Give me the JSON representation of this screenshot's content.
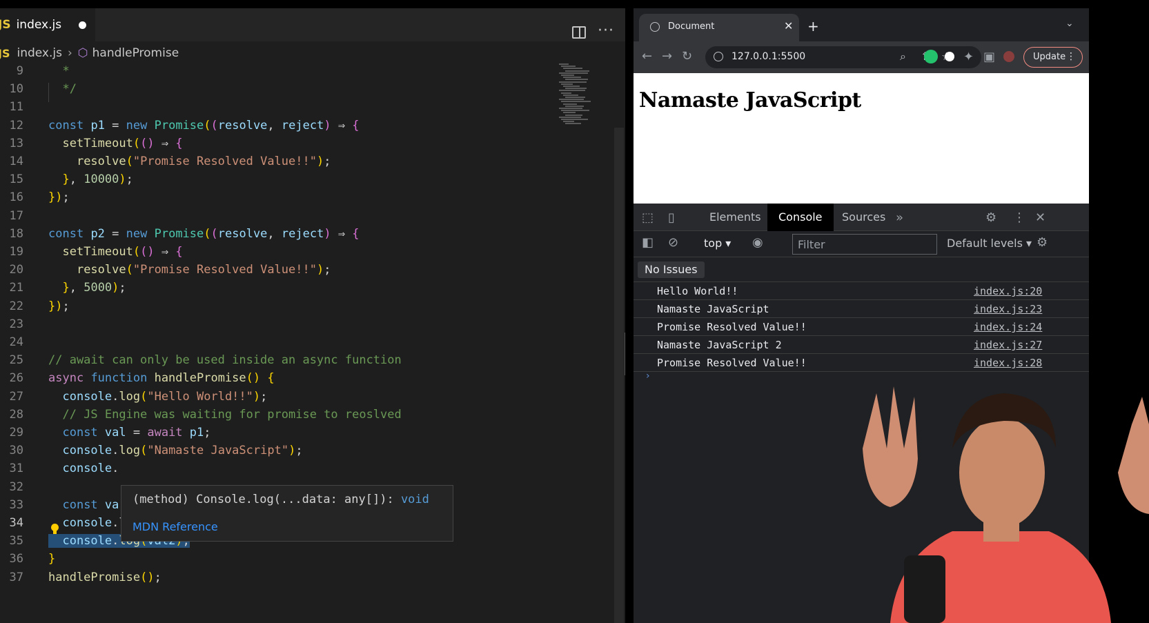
{
  "editor": {
    "tab": {
      "lang_badge": "JS",
      "title": "index.js"
    },
    "breadcrumb": {
      "lang_badge": "JS",
      "file": "index.js",
      "symbol": "handlePromise"
    },
    "lines": [
      {
        "n": "9",
        "code": "  *"
      },
      {
        "n": "10",
        "code": "  */"
      },
      {
        "n": "11",
        "code": ""
      },
      {
        "n": "12",
        "code": "const p1 = new Promise((resolve, reject) ⇒ {"
      },
      {
        "n": "13",
        "code": "  setTimeout(() ⇒ {"
      },
      {
        "n": "14",
        "code": "    resolve(\"Promise Resolved Value!!\");"
      },
      {
        "n": "15",
        "code": "  }, 10000);"
      },
      {
        "n": "16",
        "code": "});"
      },
      {
        "n": "17",
        "code": ""
      },
      {
        "n": "18",
        "code": "const p2 = new Promise((resolve, reject) ⇒ {"
      },
      {
        "n": "19",
        "code": "  setTimeout(() ⇒ {"
      },
      {
        "n": "20",
        "code": "    resolve(\"Promise Resolved Value!!\");"
      },
      {
        "n": "21",
        "code": "  }, 5000);"
      },
      {
        "n": "22",
        "code": "});"
      },
      {
        "n": "23",
        "code": ""
      },
      {
        "n": "24",
        "code": ""
      },
      {
        "n": "25",
        "code": "// await can only be used inside an async function"
      },
      {
        "n": "26",
        "code": "async function handlePromise() {"
      },
      {
        "n": "27",
        "code": "  console.log(\"Hello World!!\");"
      },
      {
        "n": "28",
        "code": "  // JS Engine was waiting for promise to reoslved"
      },
      {
        "n": "29",
        "code": "  const val = await p1;"
      },
      {
        "n": "30",
        "code": "  console.log(\"Namaste JavaScript\");"
      },
      {
        "n": "31",
        "code": "  console."
      },
      {
        "n": "32",
        "code": ""
      },
      {
        "n": "33",
        "code": "  const va"
      },
      {
        "n": "34",
        "code": "  console.log(\"Namaste JavaScript 2\");"
      },
      {
        "n": "35",
        "code": "  console.log(val2);"
      },
      {
        "n": "36",
        "code": "}"
      },
      {
        "n": "37",
        "code": "handlePromise();"
      }
    ],
    "hover": {
      "signature": "(method) Console.log(...data: any[]): ",
      "return_type": "void",
      "link": "MDN Reference"
    }
  },
  "browser": {
    "tab_title": "Document",
    "url": "127.0.0.1:5500",
    "update_label": "Update",
    "page_heading": "Namaste JavaScript",
    "devtools": {
      "tabs": [
        "Elements",
        "Console",
        "Sources"
      ],
      "active_tab": "Console",
      "context": "top",
      "filter_placeholder": "Filter",
      "levels": "Default levels",
      "issues": "No Issues",
      "logs": [
        {
          "message": "Hello World!!",
          "source": "index.js:20"
        },
        {
          "message": "Namaste JavaScript",
          "source": "index.js:23"
        },
        {
          "message": "Promise Resolved Value!!",
          "source": "index.js:24"
        },
        {
          "message": "Namaste JavaScript 2",
          "source": "index.js:27"
        },
        {
          "message": "Promise Resolved Value!!",
          "source": "index.js:28"
        }
      ]
    }
  },
  "colors": {
    "editor_bg": "#1e1e1e",
    "keyword": "#569cd6",
    "string": "#ce9178",
    "function": "#dcdcaa",
    "comment": "#6a9955",
    "selection": "#264f78",
    "link": "#3794ff"
  }
}
